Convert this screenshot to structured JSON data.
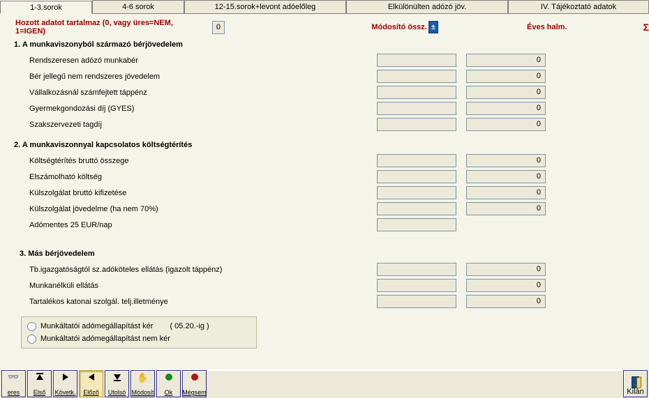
{
  "tabs": {
    "t0": "1-3.sorok",
    "t1": "4-6 sorok",
    "t2": "12-15.sorok+levont adóelőleg",
    "t3": "Elkülönülten adózó jöv.",
    "t4": "IV. Tájékoztató adatok"
  },
  "header": {
    "carried": "Hozott adatot  tartalmaz (0, vagy üres=NEM, 1=IGEN)",
    "carried_val": "0",
    "mod": "Módosító össz.",
    "annual": "Éves halm.",
    "sigma": "Σ",
    "pm": "±"
  },
  "sec1": {
    "title": "1. A munkaviszonyból származó bérjövedelem",
    "r": [
      {
        "l": "Rendszeresen adózó munkabér",
        "a": "",
        "b": "0"
      },
      {
        "l": "Bér jellegű nem rendszeres jövedelem",
        "a": "",
        "b": "0"
      },
      {
        "l": "Vállalkozásnál számfejtett táppénz",
        "a": "",
        "b": "0"
      },
      {
        "l": "Gyermekgondozási díj (GYES)",
        "a": "",
        "b": "0"
      },
      {
        "l": "Szakszervezeti tagdíj",
        "a": "",
        "b": "0"
      }
    ]
  },
  "sec2": {
    "title": "2. A munkaviszonnyal kapcsolatos költségtérítés",
    "r": [
      {
        "l": "Költségtérítés bruttó összege",
        "a": "",
        "b": "0"
      },
      {
        "l": "Elszámolható költség",
        "a": "",
        "b": "0"
      },
      {
        "l": "Külszolgálat bruttó kifizetése",
        "a": "",
        "b": "0"
      },
      {
        "l": "Külszolgálat jövedelme (ha nem 70%)",
        "a": "",
        "b": "0"
      },
      {
        "l": "Adómentes 25 EUR/nap",
        "a": "",
        "b": ""
      }
    ]
  },
  "sec3": {
    "title": "3. Más bérjövedelem",
    "r": [
      {
        "l": "Tb.igazgatóságtól sz.adóköteles ellátás (igazolt táppénz)",
        "a": "",
        "b": "0"
      },
      {
        "l": "Munkanélküli ellátás",
        "a": "",
        "b": "0"
      },
      {
        "l": "Tartalékos katonai szolgál. telj.illetménye",
        "a": "",
        "b": "0"
      }
    ]
  },
  "radio": {
    "a": "Munkáltatói adómegállapítást kér",
    "date": "( 05.20.-ig )",
    "b": "Munkáltatói  adómegállapítást nem kér"
  },
  "tb": {
    "keres": "eres",
    "elso": "Első",
    "kovetk": "Követk.",
    "elozo": "Előző",
    "utolso": "Utolsó",
    "modosit": "Módosít",
    "ok": "Ok",
    "megsem": "Mégsem",
    "kilep": "Kilán"
  }
}
